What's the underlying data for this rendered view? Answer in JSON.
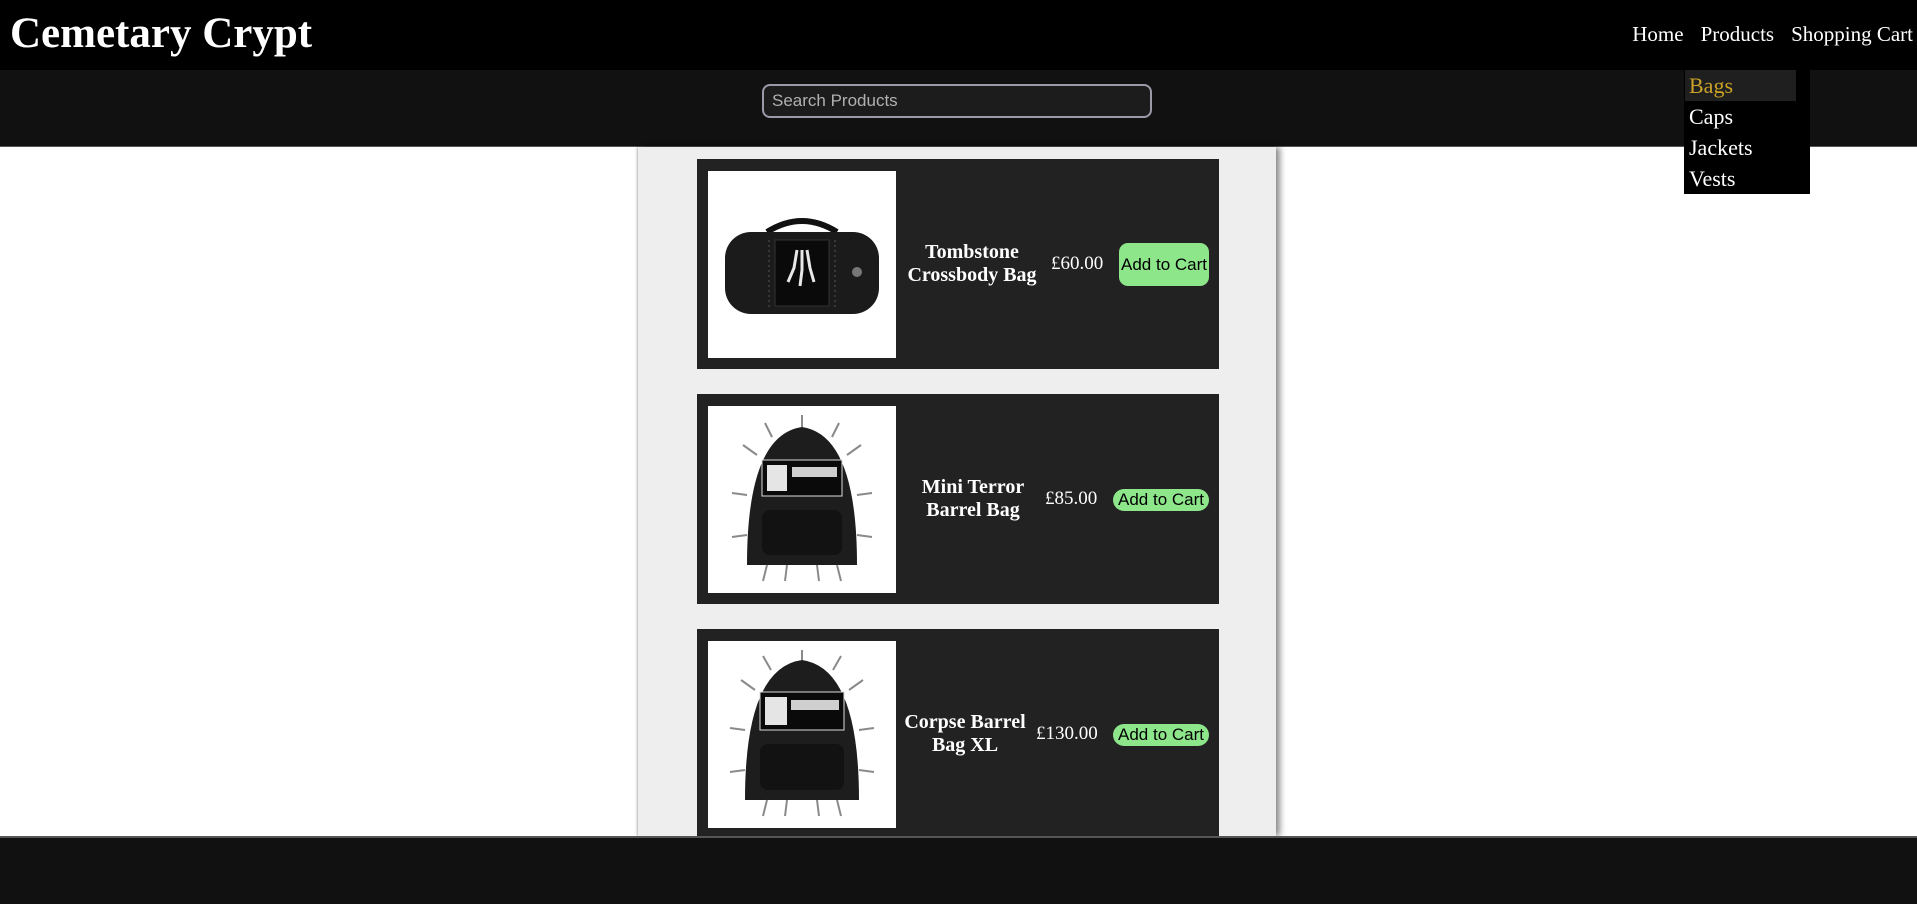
{
  "header": {
    "title": "Cemetary Crypt",
    "nav": [
      "Home",
      "Products",
      "Shopping Cart"
    ]
  },
  "search": {
    "placeholder": "Search Products"
  },
  "dropdown": {
    "items": [
      "Bags",
      "Caps",
      "Jackets",
      "Vests"
    ],
    "active": "Bags"
  },
  "products": [
    {
      "name": "Tombstone Crossbody Bag",
      "price": "£60.00",
      "button": "Add to Cart",
      "icon": "duffel-bag-icon"
    },
    {
      "name": "Mini Terror Barrel Bag",
      "price": "£85.00",
      "button": "Add to Cart",
      "icon": "spiked-backpack-icon"
    },
    {
      "name": "Corpse Barrel Bag XL",
      "price": "£130.00",
      "button": "Add to Cart",
      "icon": "spiked-backpack-icon"
    }
  ],
  "colors": {
    "header_bg": "#000000",
    "card_bg": "#222222",
    "button_bg": "#8ee68a",
    "active_menu": "#c9a227"
  }
}
